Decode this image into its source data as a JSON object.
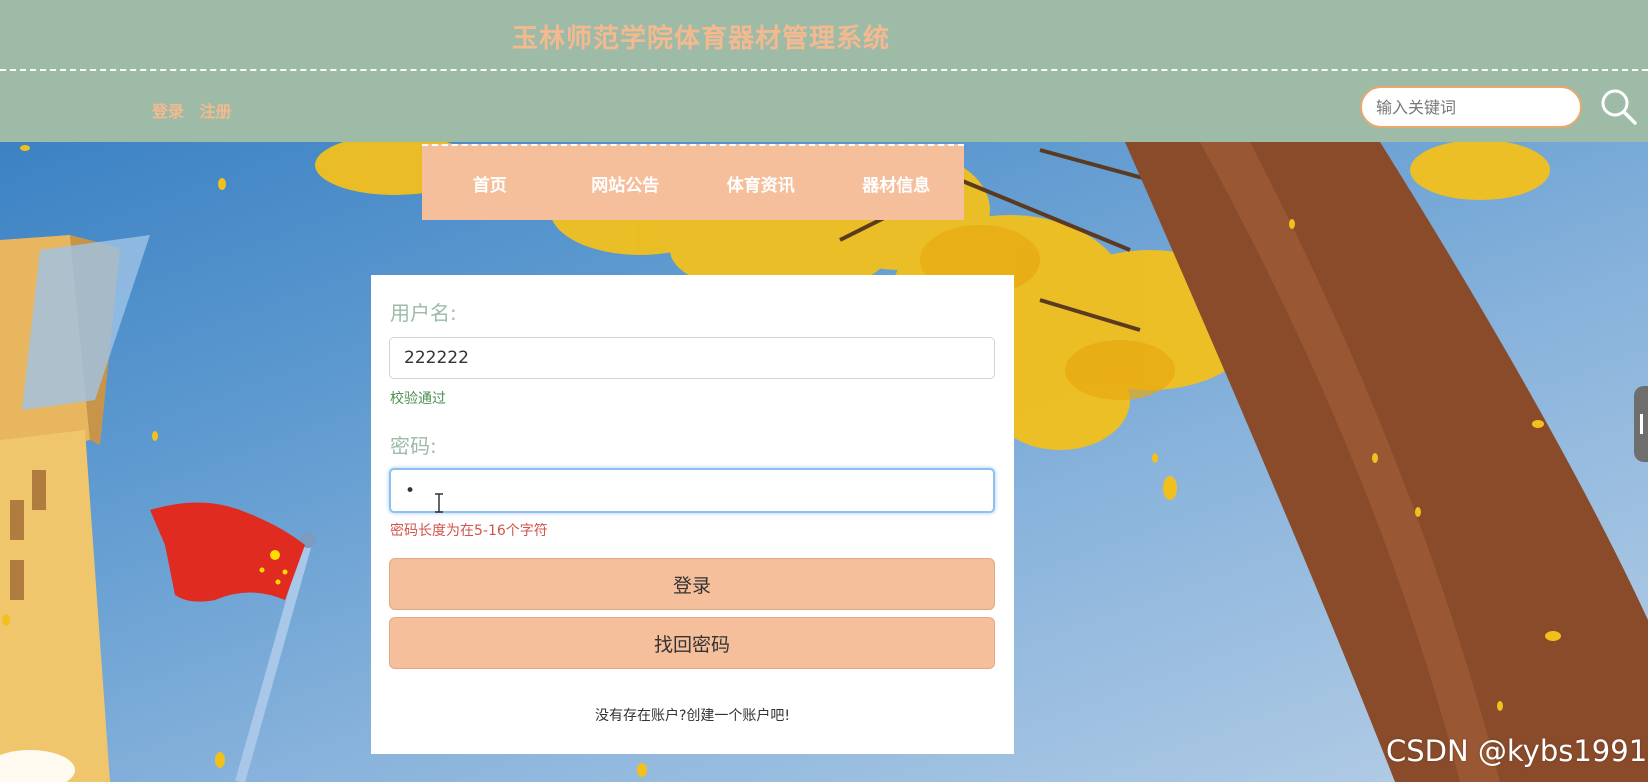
{
  "header": {
    "site_title": "玉林师范学院体育器材管理系统",
    "login_link": "登录",
    "register_link": "注册",
    "search_placeholder": "输入关键词",
    "search_icon": "search-icon"
  },
  "nav": {
    "items": [
      {
        "label": "首页"
      },
      {
        "label": "网站公告"
      },
      {
        "label": "体育资讯"
      },
      {
        "label": "器材信息"
      }
    ]
  },
  "login_form": {
    "username_label": "用户名:",
    "username_value": "222222",
    "username_status": "校验通过",
    "password_label": "密码:",
    "password_value": "•",
    "password_error": "密码长度为在5-16个字符",
    "login_button": "登录",
    "recover_button": "找回密码",
    "signup_hint": "没有存在账户?创建一个账户吧!"
  },
  "watermark": "CSDN @kybs1991",
  "colors": {
    "header_bg": "#9dbba7",
    "accent": "#f5bf9c",
    "title": "#f5b98f",
    "ok": "#4d8f4f",
    "error": "#d0544a"
  }
}
